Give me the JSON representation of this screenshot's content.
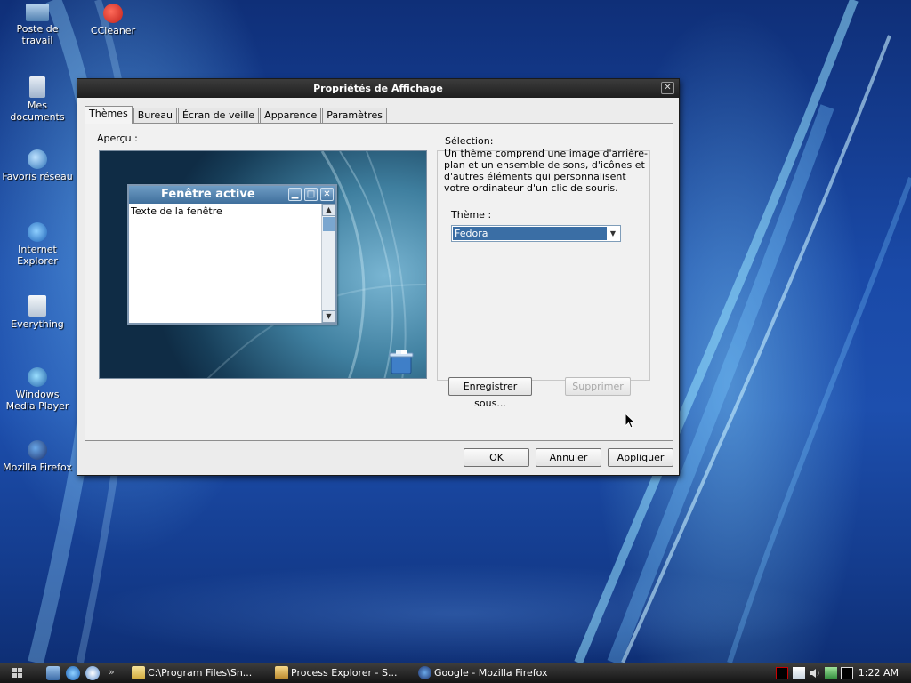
{
  "desktop": {
    "icons": [
      {
        "label": "Poste de travail"
      },
      {
        "label": "CCleaner"
      },
      {
        "label": "Mes documents"
      },
      {
        "label": "Favoris réseau"
      },
      {
        "label": "Internet Explorer"
      },
      {
        "label": "Everything"
      },
      {
        "label": "Windows Media Player"
      },
      {
        "label": "Mozilla Firefox"
      }
    ]
  },
  "dialog": {
    "title": "Propriétés de Affichage",
    "close_glyph": "✕",
    "tabs": [
      {
        "label": "Thèmes",
        "active": true
      },
      {
        "label": "Bureau"
      },
      {
        "label": "Écran de veille"
      },
      {
        "label": "Apparence"
      },
      {
        "label": "Paramètres"
      }
    ],
    "preview": {
      "label": "Aperçu :",
      "window_title": "Fenêtre active",
      "window_text": "Texte de la fenêtre"
    },
    "selection": {
      "label": "Sélection:",
      "description": "Un thème comprend une image d'arrière-plan et un ensemble de sons, d'icônes et d'autres éléments qui personnalisent votre ordinateur d'un clic de souris.",
      "theme_label": "Thème :",
      "theme_value": "Fedora",
      "save_button": "Enregistrer sous...",
      "delete_button": "Supprimer"
    },
    "buttons": {
      "ok": "OK",
      "cancel": "Annuler",
      "apply": "Appliquer"
    }
  },
  "taskbar": {
    "tasks": [
      {
        "label": "C:\\Program Files\\Sn..."
      },
      {
        "label": "Process Explorer - S..."
      },
      {
        "label": "Google - Mozilla Firefox"
      }
    ],
    "overflow": "»",
    "clock": "1:22 AM"
  }
}
